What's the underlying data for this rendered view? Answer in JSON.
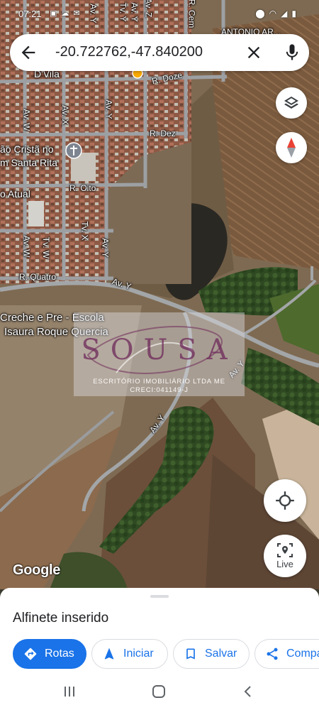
{
  "status_bar": {
    "time": "07:21",
    "left_icons": [
      "image-icon",
      "cloud-icon",
      "mail-icon"
    ],
    "right_icons": [
      "location-icon",
      "wifi-icon",
      "signal-icon",
      "battery-icon"
    ]
  },
  "search": {
    "query": "-20.722762,-47.840200",
    "back_icon": "arrow-back-icon",
    "clear_icon": "close-icon",
    "mic_icon": "mic-icon"
  },
  "map": {
    "road_labels": [
      "R. Doze",
      "R. Dez",
      "R. Oito",
      "R. Quatro",
      "Av. Y",
      "Av. Y",
      "Av. Y",
      "Av. Y",
      "Av. Y",
      "Av. Y",
      "Av. X",
      "Av. W",
      "Av. W",
      "Tv. W",
      "Tv. X",
      "Tv. Y",
      "Av. Y",
      "R. Cem",
      "Av. Z"
    ],
    "place_labels": {
      "school_line1": "Creche e Pre - Escola",
      "school_line2": "Isaura Roque Quercia",
      "church_line1": "ão Cristã no",
      "church_line2": "m Santa Rita",
      "atual": "o Atual",
      "dvila": "D'Vila",
      "antonio": "ANTONIO AR..."
    },
    "attribution": "Google",
    "colors": {
      "marker_red": "#e94235",
      "marker_yellow": "#f9ab00",
      "field_brown": "#8a6a4a",
      "vegetation": "#3f5a2c"
    }
  },
  "watermark": {
    "brand": "SOUSA",
    "line1": "ESCRITÓRIO IMOBILIÁRIO LTDA ME",
    "line2": "CRECI:041149-J"
  },
  "map_buttons": {
    "layers_icon": "layers-icon",
    "compass_icon": "compass-icon",
    "my_location_icon": "crosshair-icon",
    "live_icon": "live-view-icon",
    "live_label": "Live"
  },
  "sheet": {
    "title": "Alfinete inserido",
    "actions": [
      {
        "label": "Rotas",
        "icon": "directions-icon"
      },
      {
        "label": "Iniciar",
        "icon": "navigation-icon"
      },
      {
        "label": "Salvar",
        "icon": "bookmark-icon"
      },
      {
        "label": "Compartilhar",
        "icon": "share-icon"
      }
    ]
  },
  "nav_bar": {
    "recents_icon": "recents-icon",
    "home_icon": "home-icon",
    "back_icon": "back-icon"
  }
}
